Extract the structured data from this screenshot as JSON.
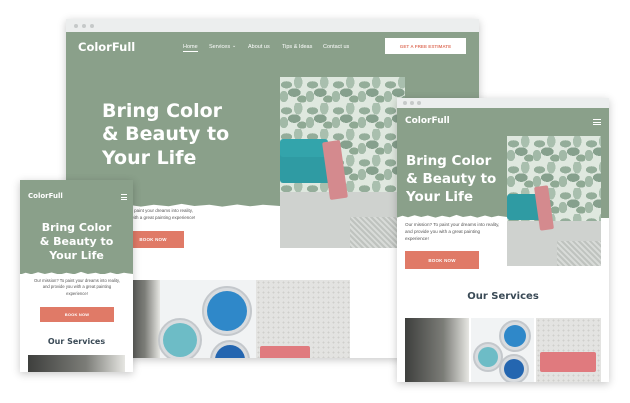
{
  "brand": "ColorFull",
  "nav": [
    "Home",
    "Services",
    "About us",
    "Tips & Ideas",
    "Contact us"
  ],
  "estimate_button": "GET A FREE ESTIMATE",
  "hero": {
    "title": "Bring Color\n& Beauty to\nYour Life",
    "mission": "Our mission? To paint your dreams into reality, and provide you with a great painting experience!",
    "mission_desktop_partial": "n? To paint your dreams into reality,\nyou with a great painting experience!",
    "book_button": "BOOK NOW",
    "book_button_partial": "BOOK NOW"
  },
  "services_heading": "Our Services",
  "colors": {
    "sage": "#8aa08a",
    "accent": "#e07a67",
    "teal": "#2f9ba3",
    "heading": "#3a4a56"
  },
  "icons": [
    "hamburger-menu-icon",
    "chevron-down-icon"
  ]
}
